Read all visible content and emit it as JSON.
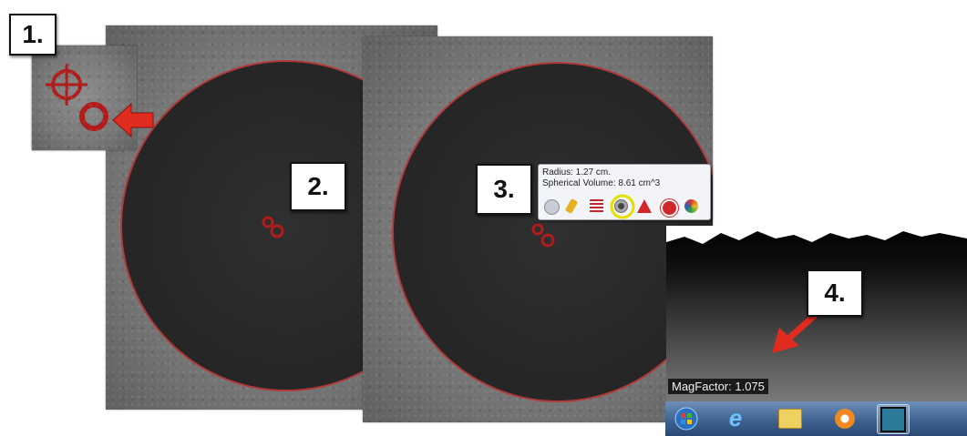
{
  "step_labels": [
    "1.",
    "2.",
    "3.",
    "4."
  ],
  "tooltip": {
    "radius_text": "Radius: 1.27 cm.",
    "volume_text": "Spherical Volume: 8.61 cm^3",
    "icons": [
      "magnify-icon",
      "pen-icon",
      "list-icon",
      "circle-tool-icon",
      "warning-icon",
      "delete-icon",
      "palette-icon"
    ]
  },
  "magfactor_text": "MagFactor: 1.075",
  "taskbar_apps": [
    "windows-start-icon",
    "internet-explorer-icon",
    "file-explorer-icon",
    "media-player-icon",
    "viewer-app-icon"
  ],
  "colors": {
    "marker": "#b01c1c",
    "arrow": "#e02b1f",
    "highlight": "#e6e000"
  }
}
